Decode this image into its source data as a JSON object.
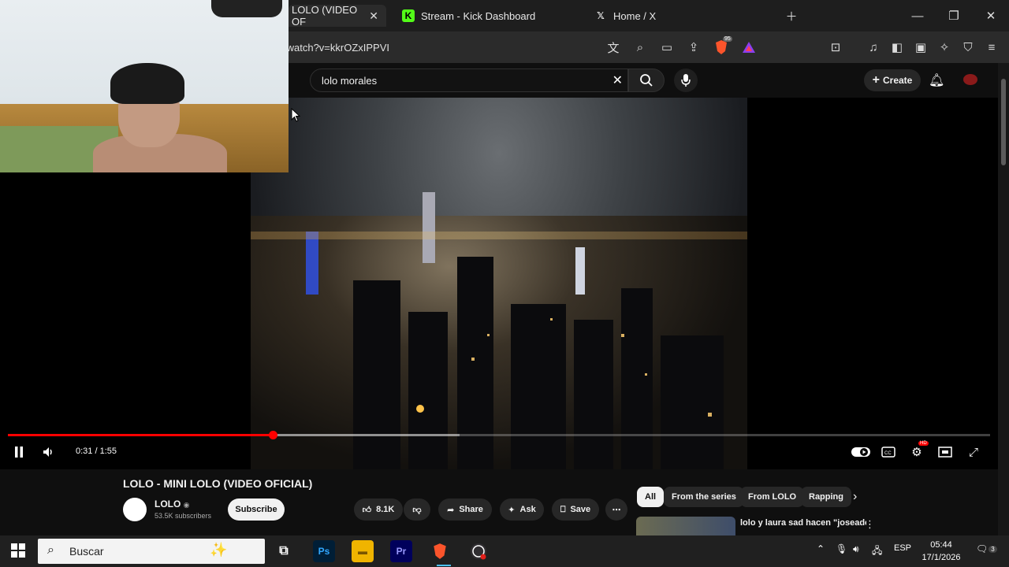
{
  "browser": {
    "tabs": [
      {
        "label": "LOLO (VIDEO OF",
        "active": true,
        "icon": "youtube-icon"
      },
      {
        "label": "Stream - Kick Dashboard",
        "active": false,
        "icon": "kick-icon"
      },
      {
        "label": "Home / X",
        "active": false,
        "icon": "x-logo-icon"
      }
    ],
    "url": "/watch?v=kkrOZxIPPVI",
    "brave_badge": "95"
  },
  "youtube": {
    "search_value": "lolo morales",
    "create_label": "Create",
    "player": {
      "time_text": "0:31 / 1:55",
      "progress_fraction": 0.27,
      "buffer_fraction": 0.46
    },
    "video": {
      "title": "LOLO - MINI LOLO (VIDEO OFICIAL)",
      "channel": "LOLO",
      "subscribers": "53.5K subscribers",
      "subscribe_label": "Subscribe",
      "likes": "8.1K",
      "share_label": "Share",
      "ask_label": "Ask",
      "save_label": "Save"
    },
    "chips": [
      "All",
      "From the series",
      "From LOLO",
      "Rapping"
    ],
    "recommendation": {
      "title": "lolo y laura sad hacen \"joseador boy\""
    }
  },
  "taskbar": {
    "search_placeholder": "Buscar",
    "language": "ESP",
    "time": "05:44",
    "date": "17/1/2026",
    "notifications": "3"
  },
  "colors": {
    "accent": "#ff0000",
    "background": "#0f0f0f",
    "brave": "#fb542b",
    "kick": "#53fc18"
  }
}
